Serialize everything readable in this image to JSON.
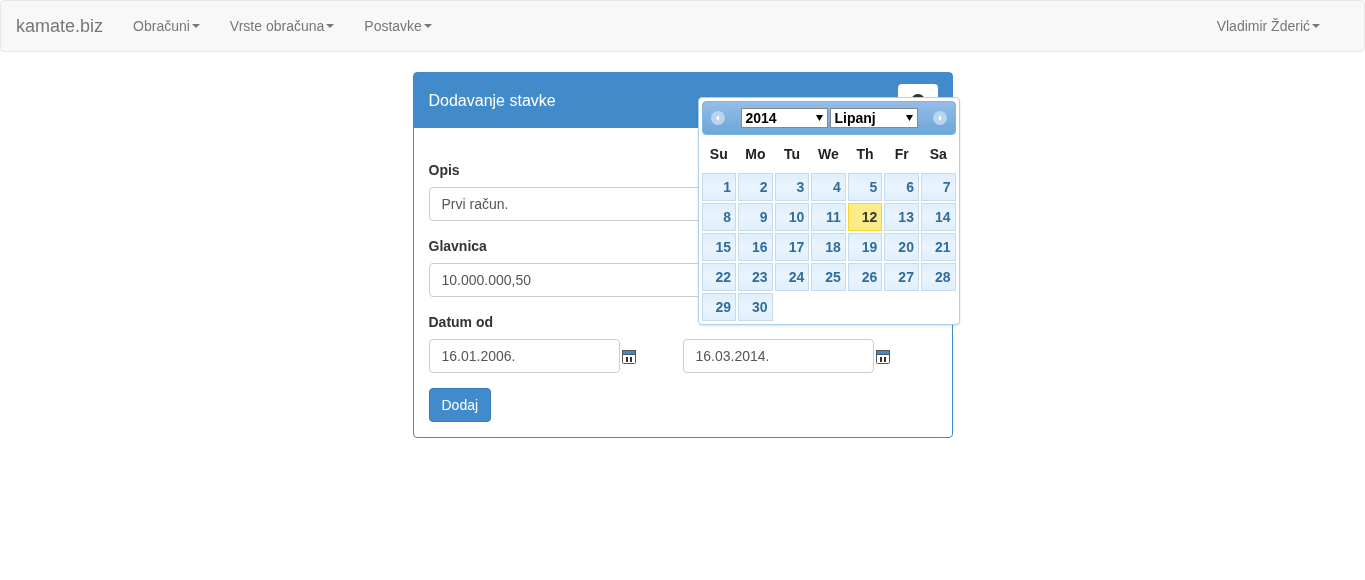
{
  "navbar": {
    "brand": "kamate.biz",
    "menus": [
      {
        "label": "Obračuni"
      },
      {
        "label": "Vrste obračuna"
      },
      {
        "label": "Postavke"
      }
    ],
    "user": {
      "label": "Vladimir Žderić"
    }
  },
  "panel": {
    "title": "Dodavanje stavke",
    "fields": [
      {
        "label": "Opis",
        "value": "Prvi račun."
      },
      {
        "label": "Glavnica",
        "value": "10.000.000,50"
      }
    ],
    "date_label": "Datum od",
    "dates": [
      {
        "value": "16.01.2006."
      },
      {
        "value": "16.03.2014."
      }
    ],
    "submit": "Dodaj"
  },
  "datepicker": {
    "year": "2014",
    "month": "Lipanj",
    "weekdays": [
      "Su",
      "Mo",
      "Tu",
      "We",
      "Th",
      "Fr",
      "Sa"
    ],
    "days": [
      {
        "label": "1",
        "selected": false
      },
      {
        "label": "2",
        "selected": false
      },
      {
        "label": "3",
        "selected": false
      },
      {
        "label": "4",
        "selected": false
      },
      {
        "label": "5",
        "selected": false
      },
      {
        "label": "6",
        "selected": false
      },
      {
        "label": "7",
        "selected": false
      },
      {
        "label": "8",
        "selected": false
      },
      {
        "label": "9",
        "selected": false
      },
      {
        "label": "10",
        "selected": false
      },
      {
        "label": "11",
        "selected": false
      },
      {
        "label": "12",
        "selected": true
      },
      {
        "label": "13",
        "selected": false
      },
      {
        "label": "14",
        "selected": false
      },
      {
        "label": "15",
        "selected": false
      },
      {
        "label": "16",
        "selected": false
      },
      {
        "label": "17",
        "selected": false
      },
      {
        "label": "18",
        "selected": false
      },
      {
        "label": "19",
        "selected": false
      },
      {
        "label": "20",
        "selected": false
      },
      {
        "label": "21",
        "selected": false
      },
      {
        "label": "22",
        "selected": false
      },
      {
        "label": "23",
        "selected": false
      },
      {
        "label": "24",
        "selected": false
      },
      {
        "label": "25",
        "selected": false
      },
      {
        "label": "26",
        "selected": false
      },
      {
        "label": "27",
        "selected": false
      },
      {
        "label": "28",
        "selected": false
      },
      {
        "label": "29",
        "selected": false
      },
      {
        "label": "30",
        "selected": false
      }
    ]
  }
}
